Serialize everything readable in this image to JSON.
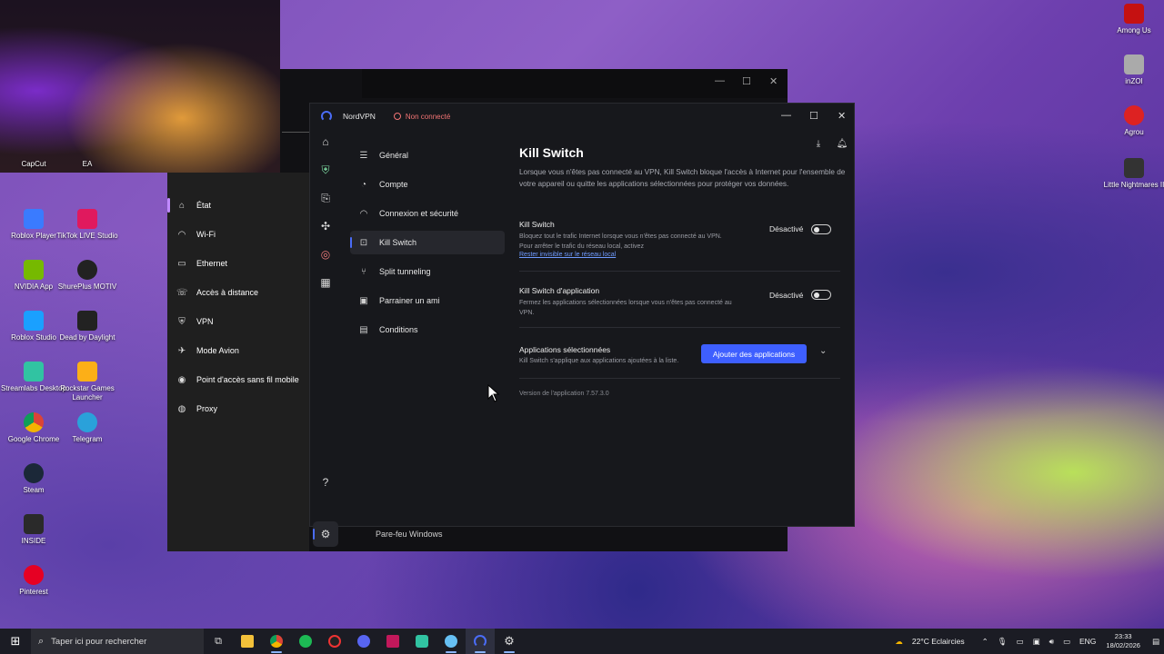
{
  "desktop": {
    "icons_left": [
      {
        "label": "CapCut",
        "color": "#1c1c1c"
      },
      {
        "label": "EA",
        "color": "#e33"
      },
      {
        "label": "Roblox Player",
        "color": "#3a7bff"
      },
      {
        "label": "TikTok LIVE Studio",
        "color": "#e0195e"
      },
      {
        "label": "NVIDIA App",
        "color": "#76b900"
      },
      {
        "label": "ShurePlus MOTIV",
        "color": "#222"
      },
      {
        "label": "Roblox Studio",
        "color": "#1aa0ff"
      },
      {
        "label": "Dead by Daylight",
        "color": "#222"
      },
      {
        "label": "Streamlabs Desktop",
        "color": "#31c3a2"
      },
      {
        "label": "Rockstar Games Launcher",
        "color": "#fcaf17"
      },
      {
        "label": "Google Chrome",
        "color": "#db4437"
      },
      {
        "label": "Telegram",
        "color": "#2aa1da"
      },
      {
        "label": "Steam",
        "color": "#1b2838"
      },
      {
        "label": "INSIDE",
        "color": "#2a2a2a"
      },
      {
        "label": "Pinterest",
        "color": "#e60023"
      }
    ],
    "icons_right": [
      {
        "label": "Among Us",
        "color": "#c51111"
      },
      {
        "label": "inZOI",
        "color": "#aaa"
      },
      {
        "label": "Agrou",
        "color": "#d22"
      },
      {
        "label": "Little Nightmares II",
        "color": "#333"
      }
    ]
  },
  "settings_panel": {
    "items": [
      {
        "label": "État",
        "icon": "⌂"
      },
      {
        "label": "Wi-Fi",
        "icon": "◠"
      },
      {
        "label": "Ethernet",
        "icon": "▭"
      },
      {
        "label": "Accès à distance",
        "icon": "☏"
      },
      {
        "label": "VPN",
        "icon": "⛨"
      },
      {
        "label": "Mode Avion",
        "icon": "✈"
      },
      {
        "label": "Point d'accès sans fil mobile",
        "icon": "◉"
      },
      {
        "label": "Proxy",
        "icon": "◍"
      }
    ]
  },
  "nordvpn": {
    "app_name": "NordVPN",
    "status": "Non connecté",
    "window_controls": {
      "minimize": "—",
      "maximize": "☐",
      "close": "✕"
    },
    "submenu": [
      {
        "label": "Général",
        "icon": "☰",
        "active": false
      },
      {
        "label": "Compte",
        "icon": "◔",
        "active": false
      },
      {
        "label": "Connexion et sécurité",
        "icon": "◠",
        "active": false
      },
      {
        "label": "Kill Switch",
        "icon": "⊡",
        "active": true
      },
      {
        "label": "Split tunneling",
        "icon": "⑂",
        "active": false
      },
      {
        "label": "Parrainer un ami",
        "icon": "▣",
        "active": false
      },
      {
        "label": "Conditions",
        "icon": "▤",
        "active": false
      }
    ],
    "page": {
      "title": "Kill Switch",
      "description": "Lorsque vous n'êtes pas connecté au VPN, Kill Switch bloque l'accès à Internet pour l'ensemble de votre appareil ou quitte les applications sélectionnées pour protéger vos données.",
      "kill_switch": {
        "title": "Kill Switch",
        "line1": "Bloquez tout le trafic Internet lorsque vous n'êtes pas connecté au VPN.",
        "line2": "Pour arrêter le trafic du réseau local, activez",
        "link": "Rester invisible sur le réseau local",
        "state": "Désactivé"
      },
      "app_kill_switch": {
        "title": "Kill Switch d'application",
        "line1": "Fermez les applications sélectionnées lorsque vous n'êtes pas connecté au",
        "line2": "VPN.",
        "state": "Désactivé"
      },
      "selected_apps": {
        "title": "Applications sélectionnées",
        "sub": "Kill Switch s'applique aux applications ajoutées à la liste.",
        "button": "Ajouter des applications"
      },
      "version": "Version de l'application 7.57.3.0"
    }
  },
  "behind_window": {
    "firewall_label": "Pare-feu Windows"
  },
  "taskbar": {
    "search_placeholder": "Taper ici pour rechercher",
    "weather": "22°C  Eclaircies",
    "lang": "ENG",
    "time": "23:33",
    "date": "18/02/2026",
    "apps": [
      {
        "name": "task-view",
        "color": "#ddd"
      },
      {
        "name": "file-explorer",
        "color": "#f3c13a"
      },
      {
        "name": "chrome",
        "color": "#db4437"
      },
      {
        "name": "spotify",
        "color": "#1db954"
      },
      {
        "name": "recording-app",
        "color": "#e33"
      },
      {
        "name": "discord",
        "color": "#5865f2"
      },
      {
        "name": "affinity",
        "color": "#c2185b"
      },
      {
        "name": "streamlabs",
        "color": "#31c3a2"
      },
      {
        "name": "steam",
        "color": "#66c0f4"
      },
      {
        "name": "nordvpn",
        "color": "#4a6cf7"
      },
      {
        "name": "settings",
        "color": "#ddd"
      }
    ]
  }
}
